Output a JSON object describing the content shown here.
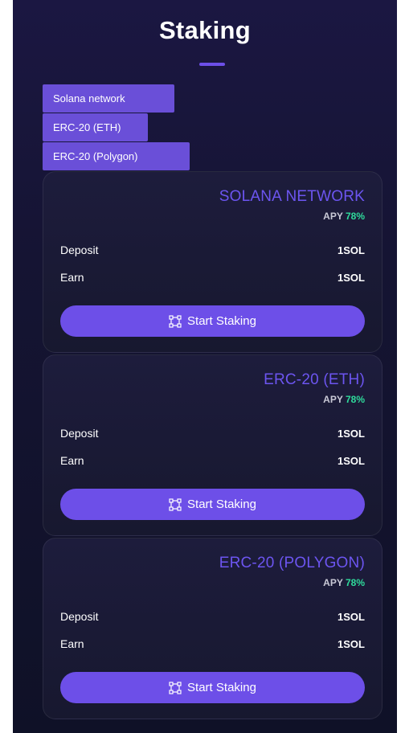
{
  "header": {
    "title": "Staking"
  },
  "tabs": [
    {
      "label": "Solana network"
    },
    {
      "label": "ERC-20 (ETH)"
    },
    {
      "label": "ERC-20 (Polygon)"
    }
  ],
  "cards": [
    {
      "network": "SOLANA NETWORK",
      "apy_label": "APY",
      "apy_value": "78%",
      "deposit_label": "Deposit",
      "deposit_value": "1SOL",
      "earn_label": "Earn",
      "earn_value": "1SOL",
      "button_label": "Start Staking"
    },
    {
      "network": "ERC-20 (ETH)",
      "apy_label": "APY",
      "apy_value": "78%",
      "deposit_label": "Deposit",
      "deposit_value": "1SOL",
      "earn_label": "Earn",
      "earn_value": "1SOL",
      "button_label": "Start Staking"
    },
    {
      "network": "ERC-20 (POLYGON)",
      "apy_label": "APY",
      "apy_value": "78%",
      "deposit_label": "Deposit",
      "deposit_value": "1SOL",
      "earn_label": "Earn",
      "earn_value": "1SOL",
      "button_label": "Start Staking"
    }
  ],
  "icons": {
    "button_icon": "staking-nodes-icon"
  },
  "colors": {
    "accent": "#6d4fe8",
    "apy_green": "#2fdc9c",
    "network_title": "#6c55f0"
  }
}
